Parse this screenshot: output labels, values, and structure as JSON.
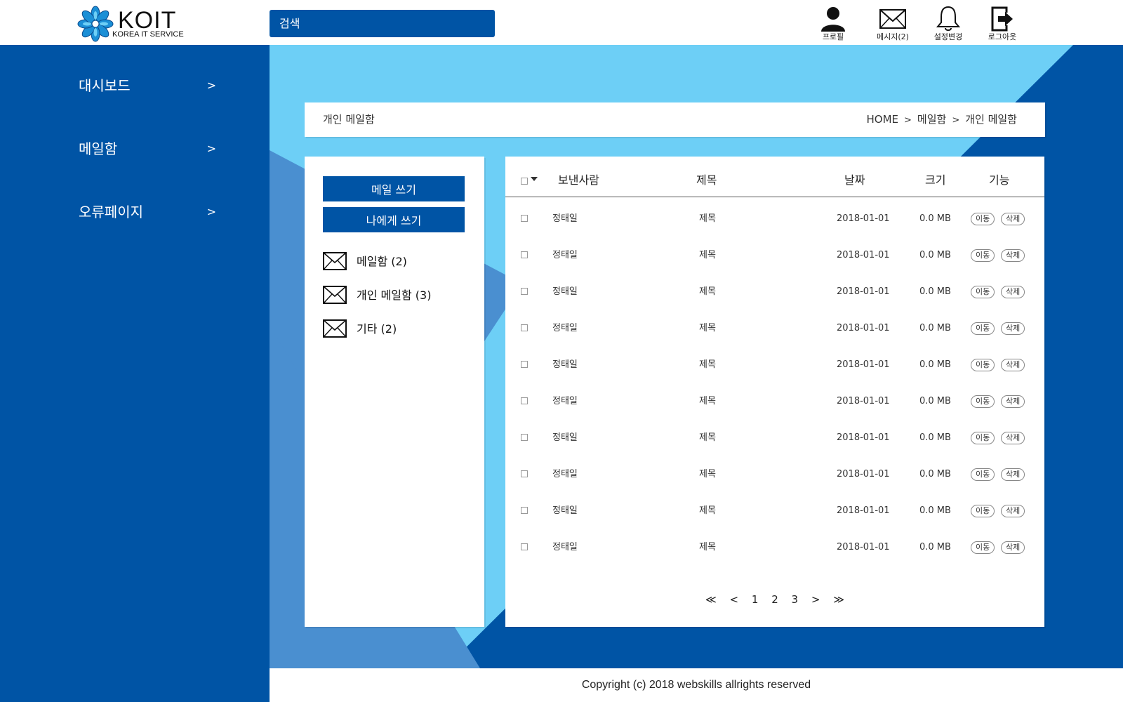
{
  "brand": {
    "name": "KOIT",
    "subtitle": "KOREA IT SERVICE",
    "colors": {
      "primary": "#0054a5",
      "light": "#6dcff6",
      "mid": "#4a8fd0"
    }
  },
  "search": {
    "placeholder": "검색"
  },
  "top_nav": [
    {
      "label": "프로필",
      "icon": "user-icon"
    },
    {
      "label": "메시지(2)",
      "icon": "envelope-icon"
    },
    {
      "label": "설정변경",
      "icon": "bell-icon"
    },
    {
      "label": "로그아웃",
      "icon": "logout-icon"
    }
  ],
  "sidebar": {
    "items": [
      {
        "label": "대시보드",
        "arrow": ">"
      },
      {
        "label": "메일함",
        "arrow": ">"
      },
      {
        "label": "오류페이지",
        "arrow": ">"
      }
    ]
  },
  "page": {
    "title": "개인 메일함",
    "breadcrumb": [
      "HOME",
      "메일함",
      "개인 메일함"
    ],
    "breadcrumb_sep": ">"
  },
  "mail_actions": {
    "compose": "메일 쓰기",
    "to_self": "나에게 쓰기"
  },
  "folders": [
    {
      "label": "메일함 (2)"
    },
    {
      "label": "개인 메일함 (3)"
    },
    {
      "label": "기타 (2)"
    }
  ],
  "table": {
    "columns": [
      "보낸사람",
      "제목",
      "날짜",
      "크기",
      "기능"
    ],
    "rows": [
      {
        "sender": "정태일",
        "subject": "제목",
        "date": "2018-01-01",
        "size": "0.0 MB",
        "move": "이동",
        "delete": "삭제"
      },
      {
        "sender": "정태일",
        "subject": "제목",
        "date": "2018-01-01",
        "size": "0.0 MB",
        "move": "이동",
        "delete": "삭제"
      },
      {
        "sender": "정태일",
        "subject": "제목",
        "date": "2018-01-01",
        "size": "0.0 MB",
        "move": "이동",
        "delete": "삭제"
      },
      {
        "sender": "정태일",
        "subject": "제목",
        "date": "2018-01-01",
        "size": "0.0 MB",
        "move": "이동",
        "delete": "삭제"
      },
      {
        "sender": "정태일",
        "subject": "제목",
        "date": "2018-01-01",
        "size": "0.0 MB",
        "move": "이동",
        "delete": "삭제"
      },
      {
        "sender": "정태일",
        "subject": "제목",
        "date": "2018-01-01",
        "size": "0.0 MB",
        "move": "이동",
        "delete": "삭제"
      },
      {
        "sender": "정태일",
        "subject": "제목",
        "date": "2018-01-01",
        "size": "0.0 MB",
        "move": "이동",
        "delete": "삭제"
      },
      {
        "sender": "정태일",
        "subject": "제목",
        "date": "2018-01-01",
        "size": "0.0 MB",
        "move": "이동",
        "delete": "삭제"
      },
      {
        "sender": "정태일",
        "subject": "제목",
        "date": "2018-01-01",
        "size": "0.0 MB",
        "move": "이동",
        "delete": "삭제"
      },
      {
        "sender": "정태일",
        "subject": "제목",
        "date": "2018-01-01",
        "size": "0.0 MB",
        "move": "이동",
        "delete": "삭제"
      }
    ]
  },
  "pagination": {
    "first": "≪",
    "prev": "<",
    "pages": [
      "1",
      "2",
      "3"
    ],
    "next": ">",
    "last": "≫"
  },
  "footer": {
    "copyright": "Copyright (c) 2018 webskills allrights reserved"
  }
}
